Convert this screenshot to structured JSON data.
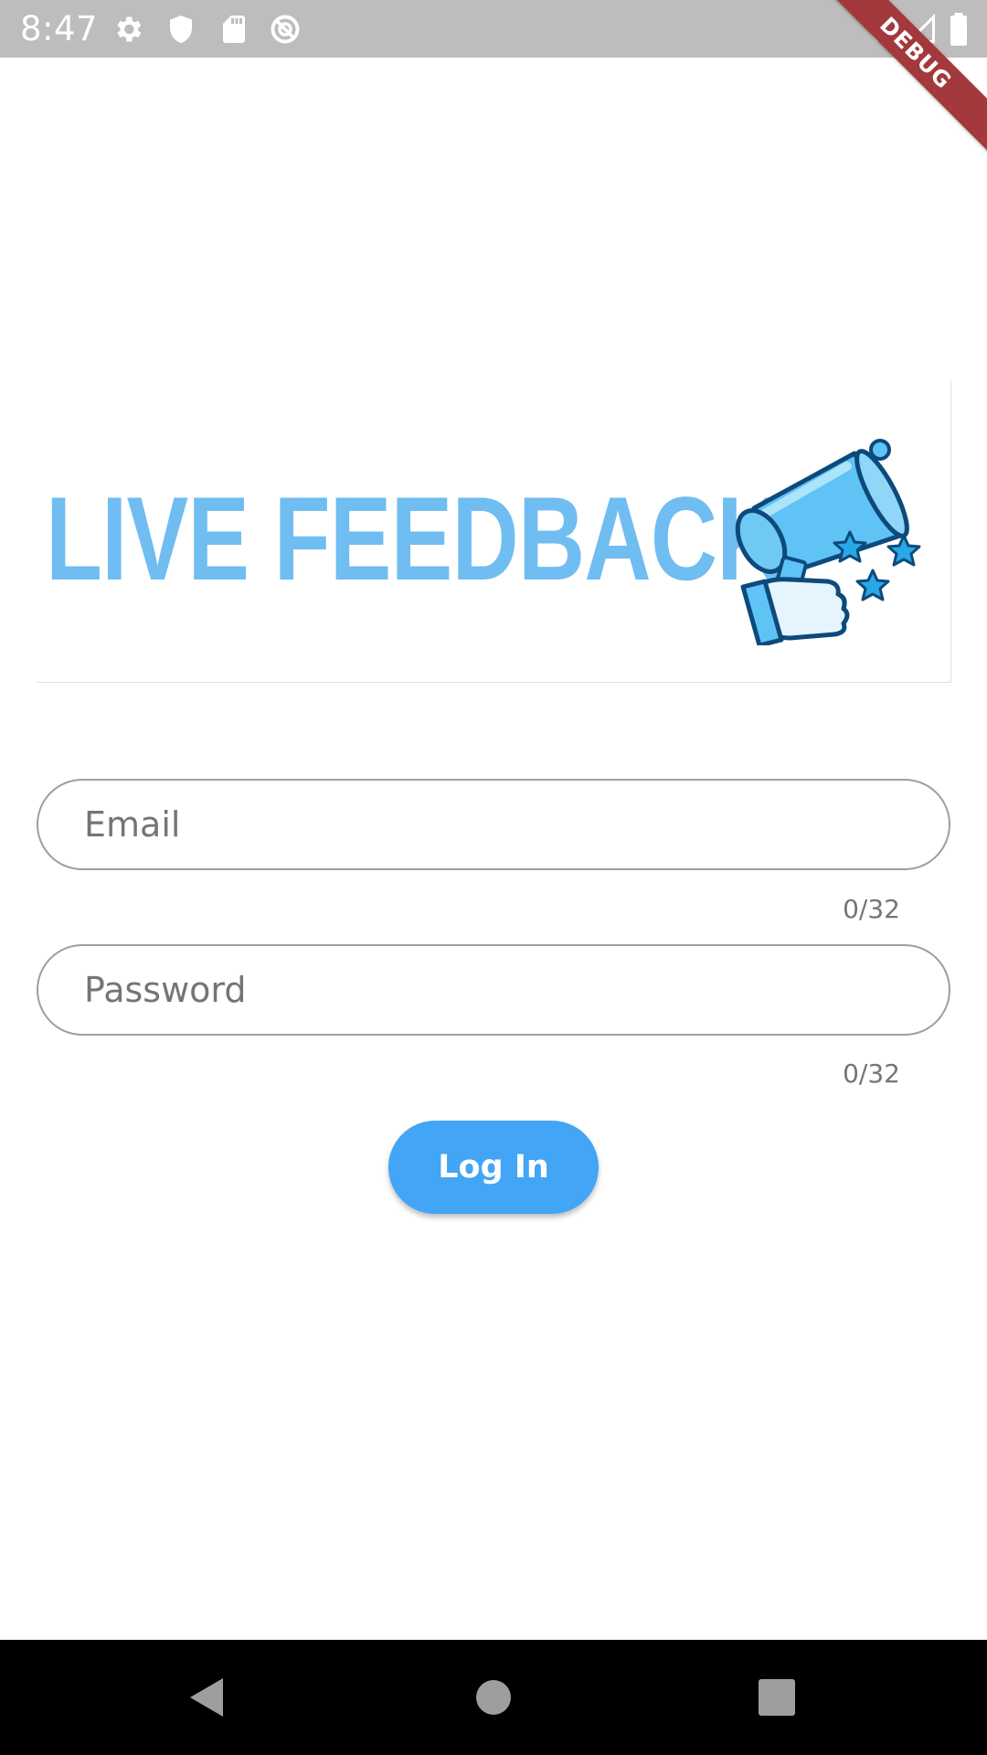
{
  "status_bar": {
    "time": "8:47",
    "icons": [
      "settings-icon",
      "shield-icon",
      "sd-card-icon",
      "do-not-disturb-icon",
      "wifi-icon",
      "signal-icon",
      "battery-icon"
    ]
  },
  "debug_banner": {
    "label": "DEBUG",
    "color": "#a3393c"
  },
  "logo": {
    "text": "LIVE FEEDBACK",
    "text_color": "#70bdf1",
    "art": "megaphone-icon"
  },
  "form": {
    "email": {
      "placeholder": "Email",
      "value": "",
      "counter": "0/32"
    },
    "password": {
      "placeholder": "Password",
      "value": "",
      "counter": "0/32"
    },
    "login_label": "Log In",
    "accent": "#42a5f5"
  },
  "nav_bar": {
    "buttons": [
      "back-icon",
      "home-icon",
      "recents-icon"
    ]
  }
}
